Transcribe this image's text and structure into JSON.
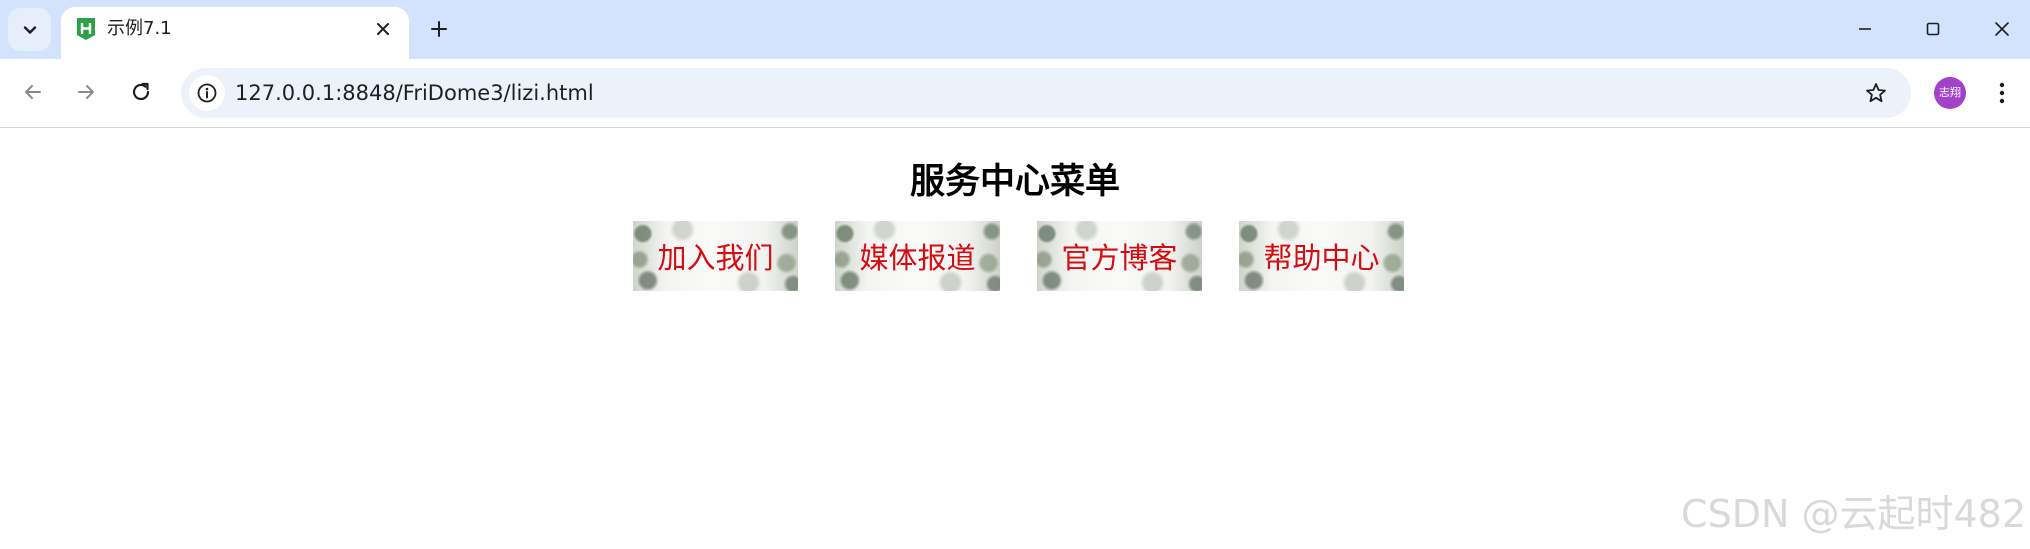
{
  "browser": {
    "tab": {
      "title": "示例7.1",
      "favicon_icon": "hbuilder-h-icon",
      "favicon_color": "#2ba245"
    },
    "address_bar": {
      "url": "127.0.0.1:8848/FriDome3/lizi.html"
    },
    "profile": {
      "avatar_text": "志翔",
      "avatar_color": "#a142c9"
    },
    "chrome_color": "#d3e3fd"
  },
  "page": {
    "title": "服务中心菜单",
    "menu": [
      {
        "label": "加入我们"
      },
      {
        "label": "媒体报道"
      },
      {
        "label": "官方博客"
      },
      {
        "label": "帮助中心"
      }
    ],
    "menu_text_color": "#d40d12"
  },
  "watermark": "CSDN @云起时482"
}
